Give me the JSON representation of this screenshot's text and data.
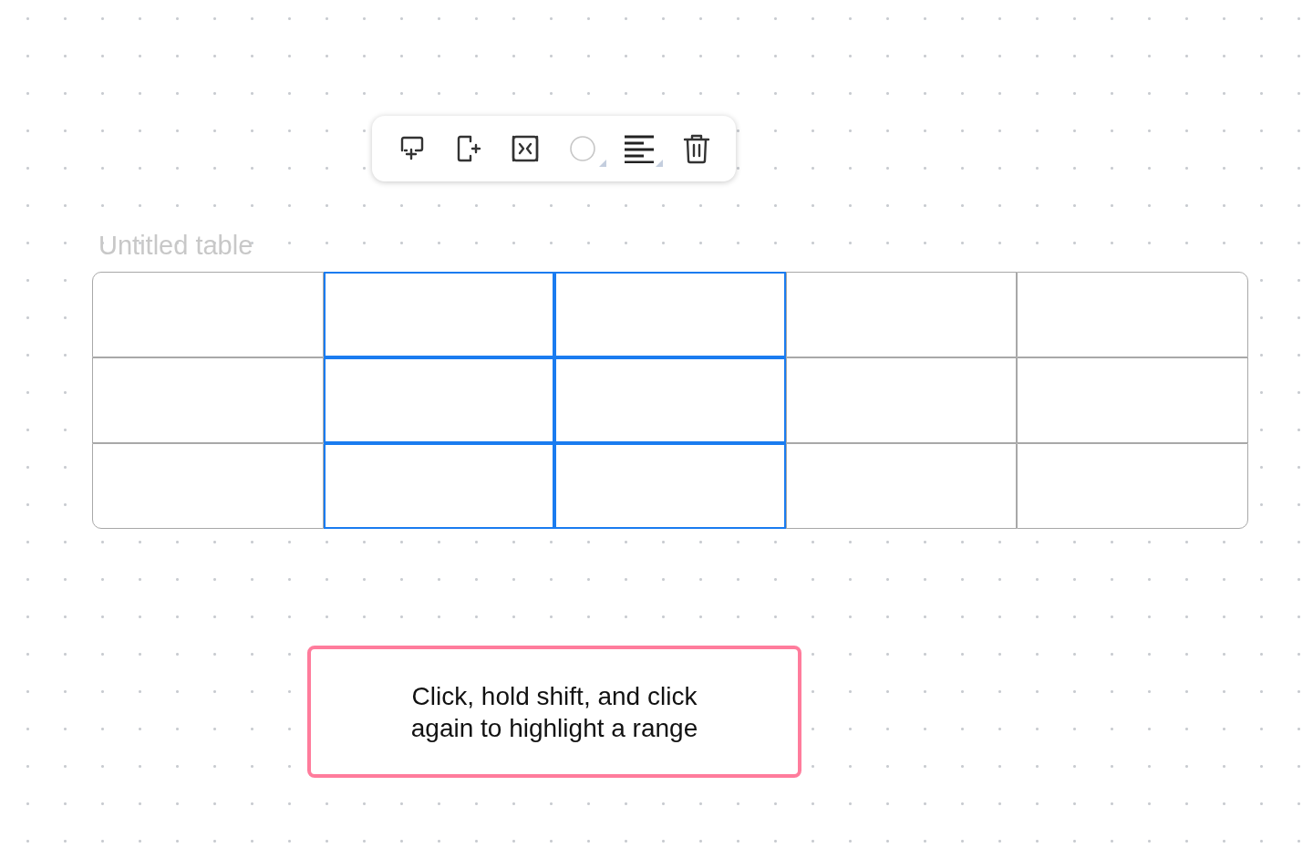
{
  "table": {
    "title": {
      "placeholder": "Untitled table"
    },
    "rows": [
      {
        "cells": [
          {
            "selected": false
          },
          {
            "selected": true
          },
          {
            "selected": true
          },
          {
            "selected": false
          },
          {
            "selected": false
          }
        ]
      },
      {
        "cells": [
          {
            "selected": false
          },
          {
            "selected": true
          },
          {
            "selected": true
          },
          {
            "selected": false
          },
          {
            "selected": false
          }
        ]
      },
      {
        "cells": [
          {
            "selected": false
          },
          {
            "selected": true
          },
          {
            "selected": true
          },
          {
            "selected": false
          },
          {
            "selected": false
          }
        ]
      }
    ]
  },
  "hint": {
    "text": "Click, hold shift, and click again to highlight a range"
  }
}
